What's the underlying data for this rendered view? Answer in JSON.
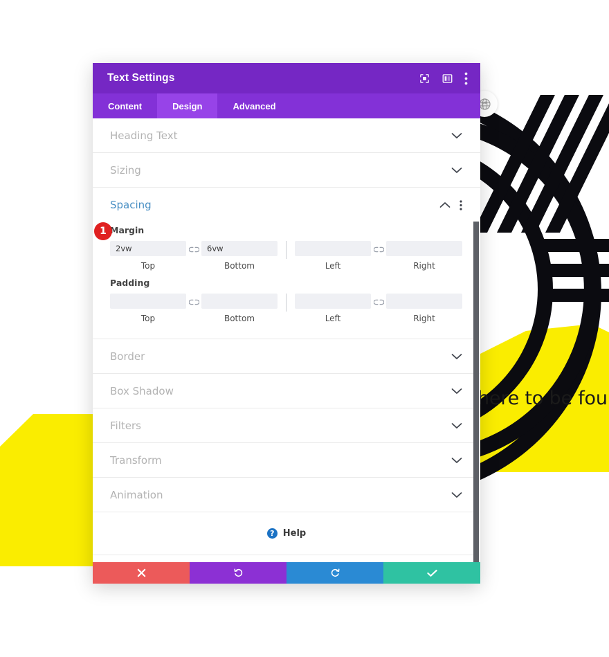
{
  "background": {
    "tagline": "here to be found.",
    "colors": {
      "yellow": "#faed00",
      "ink": "#111111",
      "page": "#ffffff"
    },
    "globe_badge_icon": "globe-icon"
  },
  "panel": {
    "title": "Text Settings",
    "header_icons": [
      {
        "name": "focus-target-icon",
        "label": "Focus"
      },
      {
        "name": "layout-columns-icon",
        "label": "Layout"
      },
      {
        "name": "more-vertical-icon",
        "label": "More options"
      }
    ],
    "tabs": [
      {
        "label": "Content",
        "active": false
      },
      {
        "label": "Design",
        "active": true
      },
      {
        "label": "Advanced",
        "active": false
      }
    ],
    "colors": {
      "header_purple": "#7527c4",
      "tabs_purple": "#8331d7",
      "active_tab_purple": "#9743e8",
      "section_open_blue": "#4a90c4",
      "badge_red": "#e02020"
    },
    "sections_before": [
      {
        "label": "Heading Text"
      },
      {
        "label": "Sizing"
      }
    ],
    "spacing_section": {
      "title": "Spacing",
      "state": "expanded",
      "badge": "1",
      "groups": [
        {
          "label": "Margin",
          "fields": [
            {
              "caption": "Top",
              "value": "2vw",
              "placeholder": ""
            },
            {
              "caption": "Bottom",
              "value": "6vw",
              "placeholder": ""
            },
            {
              "caption": "Left",
              "value": "",
              "placeholder": ""
            },
            {
              "caption": "Right",
              "value": "",
              "placeholder": ""
            }
          ]
        },
        {
          "label": "Padding",
          "fields": [
            {
              "caption": "Top",
              "value": "",
              "placeholder": ""
            },
            {
              "caption": "Bottom",
              "value": "",
              "placeholder": ""
            },
            {
              "caption": "Left",
              "value": "",
              "placeholder": ""
            },
            {
              "caption": "Right",
              "value": "",
              "placeholder": ""
            }
          ]
        }
      ]
    },
    "sections_after": [
      {
        "label": "Border"
      },
      {
        "label": "Box Shadow"
      },
      {
        "label": "Filters"
      },
      {
        "label": "Transform"
      },
      {
        "label": "Animation"
      }
    ],
    "help": {
      "label": "Help",
      "icon": "question-mark-icon"
    },
    "footer_buttons": [
      {
        "name": "cancel-button",
        "icon": "close-icon",
        "glyph": "✖",
        "color": "#ec5a5a"
      },
      {
        "name": "undo-button",
        "icon": "undo-icon",
        "glyph": "↺",
        "color": "#8c30d4"
      },
      {
        "name": "redo-button",
        "icon": "redo-icon",
        "glyph": "↻",
        "color": "#2a8ad4"
      },
      {
        "name": "save-button",
        "icon": "check-icon",
        "glyph": "✔",
        "color": "#2fc2a2"
      }
    ]
  }
}
